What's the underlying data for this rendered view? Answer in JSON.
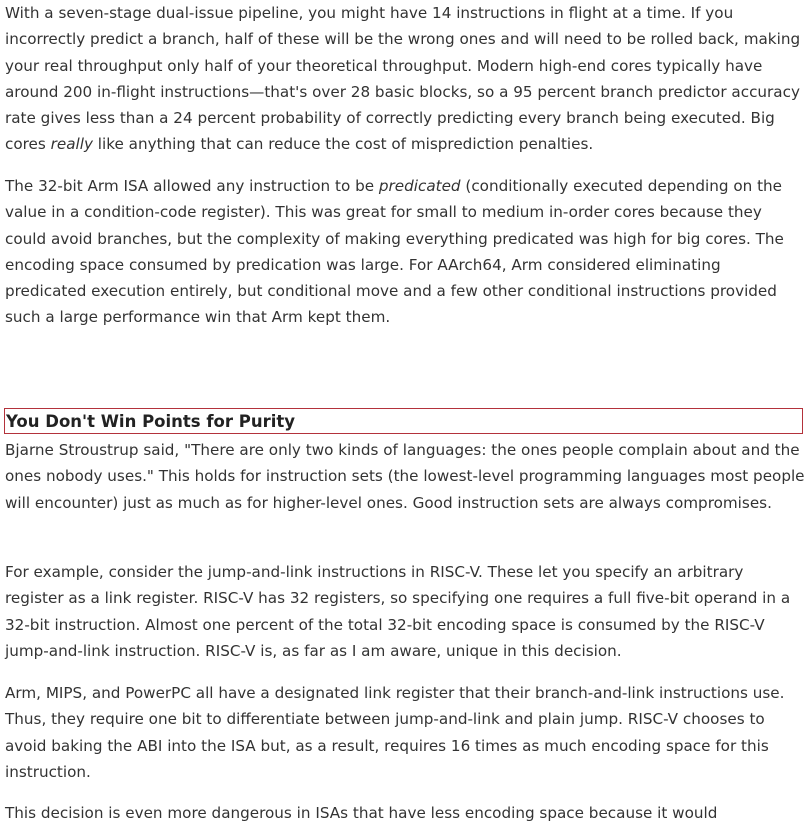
{
  "paragraphs": {
    "p1": {
      "before": "With a seven-stage dual-issue pipeline, you might have 14 instructions in flight at a time. If you incorrectly predict a branch, half of these will be the wrong ones and will need to be rolled back, making your real throughput only half of your theoretical throughput. Modern high-end cores typically have around 200 in-flight instructions—that's over 28 basic blocks, so a 95 percent branch predictor accuracy rate gives less than a 24 percent probability of correctly predicting every branch being executed. Big cores ",
      "em": "really",
      "after": " like anything that can reduce the cost of misprediction penalties."
    },
    "p2": {
      "before": "The 32-bit Arm ISA allowed any instruction to be ",
      "em": "predicated",
      "after": " (conditionally executed depending on the value in a condition-code register). This was great for small to medium in-order cores because they could avoid branches, but the complexity of making everything predicated was high for big cores. The encoding space consumed by predication was large. For AArch64, Arm considered eliminating predicated execution entirely, but conditional move and a few other conditional instructions provided such a large performance win that Arm kept them."
    },
    "heading": "You Don't Win Points for Purity",
    "p3": "Bjarne Stroustrup said, \"There are only two kinds of languages: the ones people complain about and the ones nobody uses.\" This holds for instruction sets (the lowest-level programming languages most people will encounter) just as much as for higher-level ones. Good instruction sets are always compromises.",
    "p4": "For example, consider the jump-and-link instructions in RISC-V. These let you specify an arbitrary register as a link register. RISC-V has 32 registers, so specifying one requires a full five-bit operand in a 32-bit instruction. Almost one percent of the total 32-bit encoding space is consumed by the RISC-V jump-and-link instruction. RISC-V is, as far as I am aware, unique in this decision.",
    "p5": "Arm, MIPS, and PowerPC all have a designated link register that their branch-and-link instructions use. Thus, they require one bit to differentiate between jump-and-link and plain jump. RISC-V chooses to avoid baking the ABI into the ISA but, as a result, requires 16 times as much encoding space for this instruction.",
    "p6": "This decision is even more dangerous in ISAs that have less encoding space because it would"
  }
}
